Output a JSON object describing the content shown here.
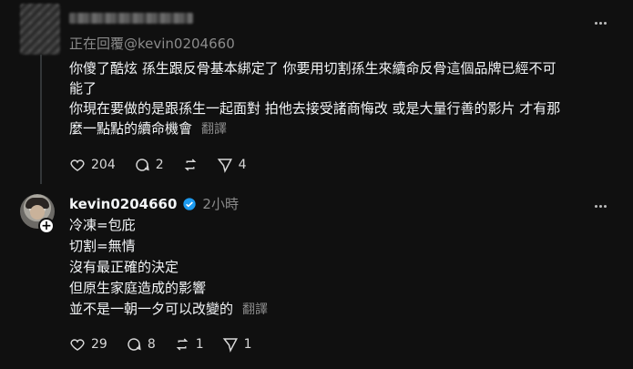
{
  "post1": {
    "replying_to": "正在回覆@kevin0204660",
    "lines": [
      "你傻了酷炫 孫生跟反骨基本綁定了 你要用切割孫生來續命反骨這個品牌已經不可",
      "能了",
      "你現在要做的是跟孫生一起面對 拍他去接受諸商悔改 或是大量行善的影片 才有那",
      "麼一點點的續命機會"
    ],
    "translate": "翻譯",
    "likes": "204",
    "comments": "2",
    "shares": "4"
  },
  "post2": {
    "username": "kevin0204660",
    "time": "2小時",
    "follow_symbol": "+",
    "lines": [
      "冷凍=包庇",
      "切割=無情",
      "沒有最正確的決定",
      "但原生家庭造成的影響",
      "並不是一朝一夕可以改變的"
    ],
    "translate": "翻譯",
    "likes": "29",
    "comments": "8",
    "reposts": "1",
    "shares": "1"
  }
}
